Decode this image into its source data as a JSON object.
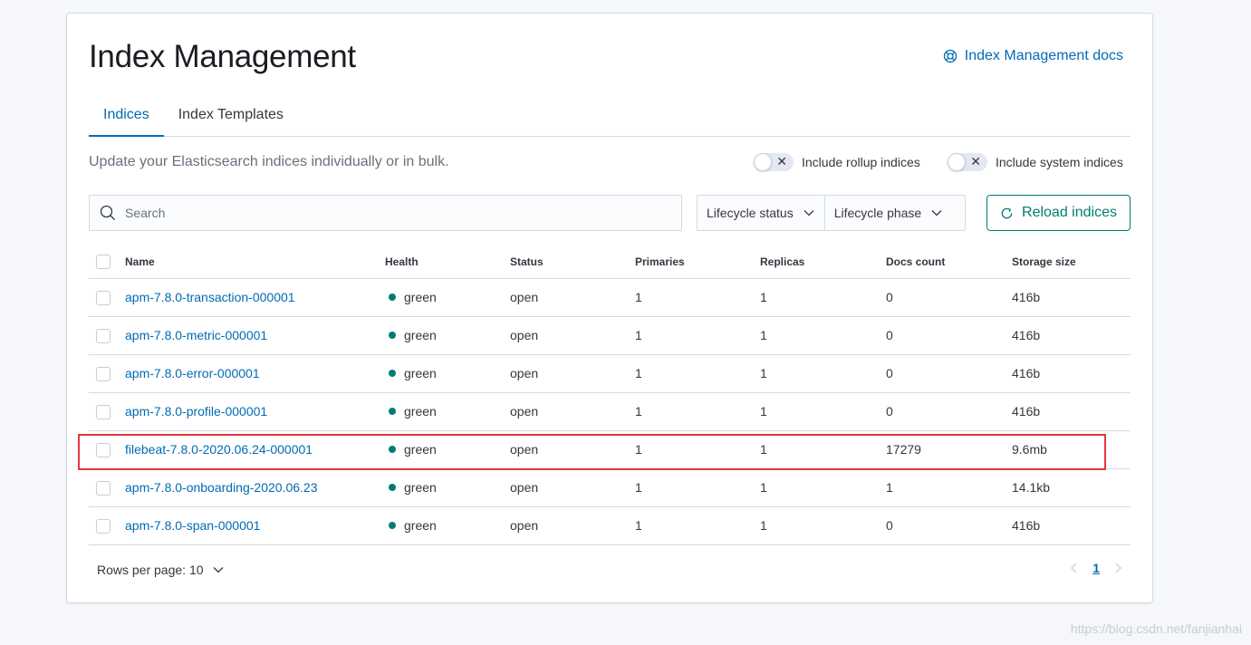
{
  "header": {
    "title": "Index Management",
    "docs_link": "Index Management docs"
  },
  "tabs": [
    {
      "label": "Indices",
      "active": true
    },
    {
      "label": "Index Templates",
      "active": false
    }
  ],
  "description": "Update your Elasticsearch indices individually or in bulk.",
  "switches": {
    "rollup": {
      "label": "Include rollup indices",
      "on": false
    },
    "system": {
      "label": "Include system indices",
      "on": false
    }
  },
  "search": {
    "placeholder": "Search",
    "value": ""
  },
  "filters": {
    "lifecycle_status": "Lifecycle status",
    "lifecycle_phase": "Lifecycle phase"
  },
  "reload_label": "Reload indices",
  "table": {
    "columns": [
      "Name",
      "Health",
      "Status",
      "Primaries",
      "Replicas",
      "Docs count",
      "Storage size"
    ],
    "rows": [
      {
        "name": "apm-7.8.0-transaction-000001",
        "health": "green",
        "status": "open",
        "primaries": "1",
        "replicas": "1",
        "docs": "0",
        "size": "416b"
      },
      {
        "name": "apm-7.8.0-metric-000001",
        "health": "green",
        "status": "open",
        "primaries": "1",
        "replicas": "1",
        "docs": "0",
        "size": "416b"
      },
      {
        "name": "apm-7.8.0-error-000001",
        "health": "green",
        "status": "open",
        "primaries": "1",
        "replicas": "1",
        "docs": "0",
        "size": "416b"
      },
      {
        "name": "apm-7.8.0-profile-000001",
        "health": "green",
        "status": "open",
        "primaries": "1",
        "replicas": "1",
        "docs": "0",
        "size": "416b"
      },
      {
        "name": "filebeat-7.8.0-2020.06.24-000001",
        "health": "green",
        "status": "open",
        "primaries": "1",
        "replicas": "1",
        "docs": "17279",
        "size": "9.6mb"
      },
      {
        "name": "apm-7.8.0-onboarding-2020.06.23",
        "health": "green",
        "status": "open",
        "primaries": "1",
        "replicas": "1",
        "docs": "1",
        "size": "14.1kb"
      },
      {
        "name": "apm-7.8.0-span-000001",
        "health": "green",
        "status": "open",
        "primaries": "1",
        "replicas": "1",
        "docs": "0",
        "size": "416b"
      }
    ]
  },
  "footer": {
    "rows_per_page": "Rows per page: 10",
    "current_page": "1"
  },
  "watermark": "https://blog.csdn.net/fanjianhai",
  "colors": {
    "link": "#006bb4",
    "health_green": "#017d73",
    "accent_teal": "#017d73",
    "highlight_red": "#e0393e"
  },
  "icons": {
    "docs": "help-icon",
    "search": "search-icon",
    "reload": "refresh-icon",
    "dropdown": "chevron-down-icon"
  }
}
